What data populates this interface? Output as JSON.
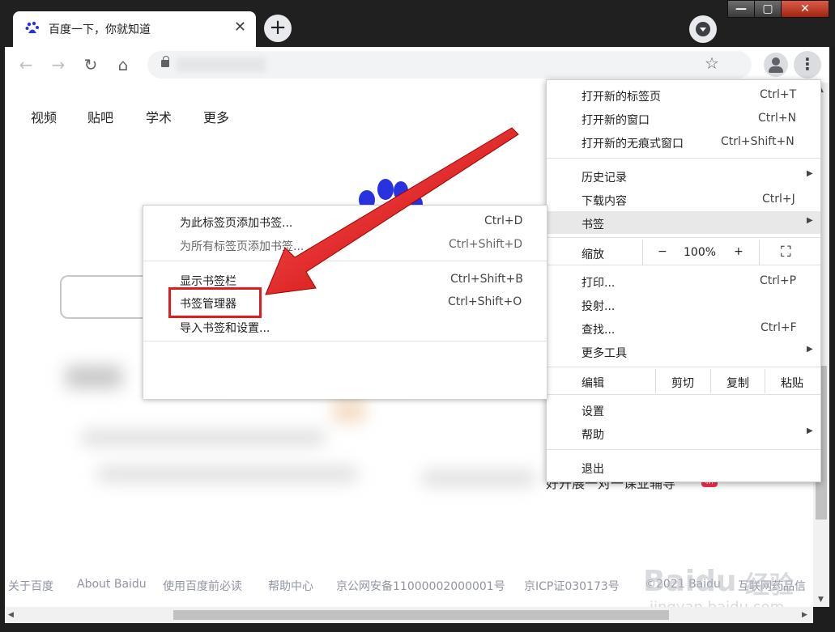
{
  "tab": {
    "title": "百度一下，你就知道",
    "close": "✕"
  },
  "titlebar": {
    "new_tab": "+",
    "minimize": "—",
    "maximize": "▢",
    "close": "✕"
  },
  "toolbar": {
    "back": "←",
    "forward": "→",
    "reload": "↻",
    "home": "⌂",
    "star": "☆",
    "menu": "⋮"
  },
  "nav": [
    "视频",
    "贴吧",
    "学术",
    "更多"
  ],
  "hot_item": {
    "text": "好开展一对一课业辅导",
    "badge": "新"
  },
  "footer": [
    "关于百度",
    "About Baidu",
    "使用百度前必读",
    "帮助中心",
    "京公网安备11000002000001号",
    "京ICP证030173号",
    "©2021 Baidu",
    "互联网药品信"
  ],
  "watermark": {
    "brand": "Baidu",
    "cn": "经验",
    "url": "jingyan.baidu.com"
  },
  "chrome_menu": {
    "items": [
      {
        "label": "打开新的标签页",
        "shortcut": "Ctrl+T"
      },
      {
        "label": "打开新的窗口",
        "shortcut": "Ctrl+N"
      },
      {
        "label": "打开新的无痕式窗口",
        "shortcut": "Ctrl+Shift+N"
      },
      {
        "label": "历史记录",
        "shortcut": ""
      },
      {
        "label": "下载内容",
        "shortcut": "Ctrl+J"
      },
      {
        "label": "书签",
        "shortcut": ""
      },
      {
        "label": "缩放",
        "shortcut": ""
      },
      {
        "label": "打印...",
        "shortcut": "Ctrl+P"
      },
      {
        "label": "投射...",
        "shortcut": ""
      },
      {
        "label": "查找...",
        "shortcut": "Ctrl+F"
      },
      {
        "label": "更多工具",
        "shortcut": ""
      },
      {
        "label": "编辑",
        "shortcut": ""
      },
      {
        "label": "设置",
        "shortcut": ""
      },
      {
        "label": "帮助",
        "shortcut": ""
      },
      {
        "label": "退出",
        "shortcut": ""
      }
    ],
    "zoom": {
      "minus": "−",
      "value": "100%",
      "plus": "+",
      "fullscreen": "⛶"
    },
    "edit": {
      "cut": "剪切",
      "copy": "复制",
      "paste": "粘贴"
    },
    "submenu_arrow": "▶"
  },
  "bookmarks_menu": {
    "items": [
      {
        "label": "为此标签页添加书签...",
        "shortcut": "Ctrl+D"
      },
      {
        "label": "为所有标签页添加书签...",
        "shortcut": "Ctrl+Shift+D"
      },
      {
        "label": "显示书签栏",
        "shortcut": "Ctrl+Shift+B"
      },
      {
        "label": "书签管理器",
        "shortcut": "Ctrl+Shift+O"
      },
      {
        "label": "导入书签和设置...",
        "shortcut": ""
      }
    ]
  },
  "colors": {
    "annotation_red": "#e21c1c",
    "baidu_blue": "#2932e1"
  }
}
